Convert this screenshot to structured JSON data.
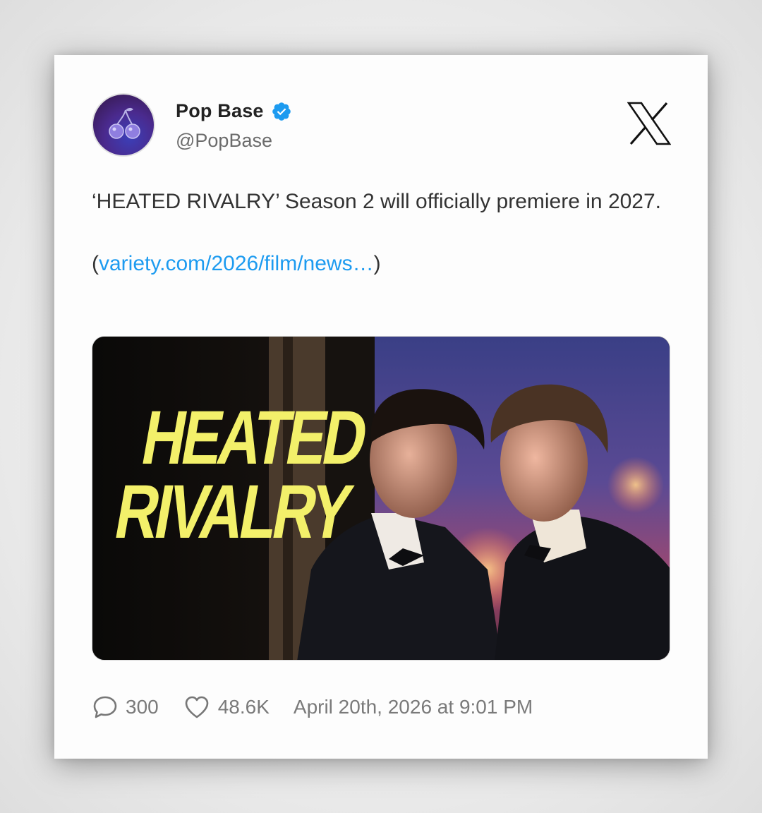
{
  "author": {
    "display_name": "Pop Base",
    "handle": "@PopBase",
    "verified": true,
    "avatar_icon": "cherry-icon"
  },
  "platform_icon": "x-logo-icon",
  "tweet": {
    "text": "‘HEATED RIVALRY’ Season 2 will officially premiere in 2027.",
    "link_prefix": "(",
    "link_text": "variety.com/2026/film/news…",
    "link_suffix": ")"
  },
  "media": {
    "title_line1": "HEATED",
    "title_line2": "RIVALRY"
  },
  "footer": {
    "replies": "300",
    "likes": "48.6K",
    "timestamp": "April 20th, 2026 at 9:01 PM"
  },
  "colors": {
    "link": "#1d9bf0",
    "verified": "#1d9bf0",
    "title_yellow": "#f3f06a"
  }
}
